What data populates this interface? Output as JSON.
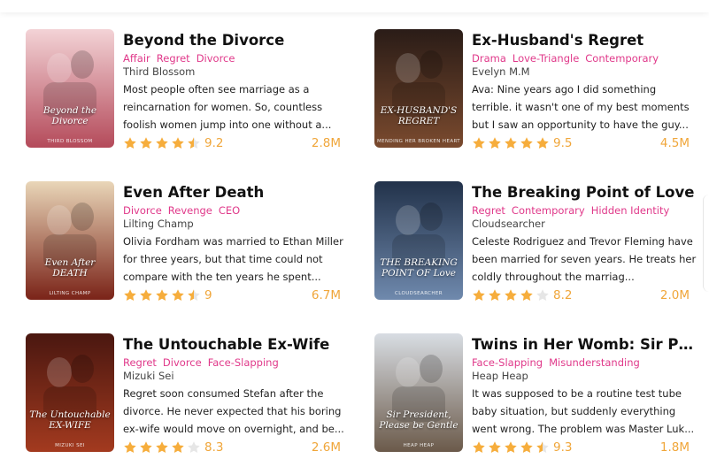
{
  "colors": {
    "accent_tag": "#e0398a",
    "star": "#f6ad3c",
    "star_empty": "#e6e6e6",
    "stat": "#f0a63a"
  },
  "books": [
    {
      "title": "Beyond the Divorce",
      "tags": [
        "Affair",
        "Regret",
        "Divorce"
      ],
      "author": "Third Blossom",
      "description": "Most people often see marriage as a reincarnation for women. So, countless foolish women jump into one without a...",
      "rating": "9.2",
      "rating_value": 4.5,
      "reads": "2.8M",
      "cover_title": "Beyond the Divorce",
      "cover_author": "THIRD BLOSSOM",
      "cover_colors": [
        "#f3d3d6",
        "#b44a5a"
      ]
    },
    {
      "title": "Ex-Husband's Regret",
      "tags": [
        "Drama",
        "Love-Triangle",
        "Contemporary"
      ],
      "author": "Evelyn M.M",
      "description": "Ava: Nine years ago I did something terrible. it wasn't one of my best moments but I saw an opportunity to have the guy...",
      "rating": "9.5",
      "rating_value": 5,
      "reads": "4.5M",
      "cover_title": "EX-HUSBAND'S REGRET",
      "cover_author": "MENDING HER BROKEN HEART",
      "cover_colors": [
        "#2a1c17",
        "#7a4a2e"
      ]
    },
    {
      "title": "Even After Death",
      "tags": [
        "Divorce",
        "Revenge",
        "CEO"
      ],
      "author": "Lilting Champ",
      "description": "Olivia Fordham was married to Ethan Miller for three years, but that time could not compare with the ten years he spent...",
      "rating": "9",
      "rating_value": 4.5,
      "reads": "6.7M",
      "cover_title": "Even After DEATH",
      "cover_author": "LILTING CHAMP",
      "cover_colors": [
        "#e9d6b8",
        "#7a2318"
      ]
    },
    {
      "title": "The Breaking Point of Love",
      "tags": [
        "Regret",
        "Contemporary",
        "Hidden Identity"
      ],
      "author": "Cloudsearcher",
      "description": "Celeste Rodriguez and Trevor Fleming have been married for seven years. He treats her coldly throughout the marriag...",
      "rating": "8.2",
      "rating_value": 4,
      "reads": "2.0M",
      "cover_title": "THE BREAKING POINT OF Love",
      "cover_author": "CLOUDSEARCHER",
      "cover_colors": [
        "#22324a",
        "#6f89ad"
      ]
    },
    {
      "title": "The Untouchable Ex-Wife",
      "tags": [
        "Regret",
        "Divorce",
        "Face-Slapping"
      ],
      "author": "Mizuki Sei",
      "description": "Regret soon consumed Stefan after the divorce. He never expected that his boring ex-wife would move on overnight, and be...",
      "rating": "8.3",
      "rating_value": 4,
      "reads": "2.6M",
      "cover_title": "The Untouchable EX-WIFE",
      "cover_author": "MIZUKI SEI",
      "cover_colors": [
        "#4a1710",
        "#a33a1f"
      ]
    },
    {
      "title": "Twins in Her Womb: Sir President, Please be Gentle",
      "tags": [
        "Face-Slapping",
        "Misunderstanding"
      ],
      "author": "Heap Heap",
      "description": "It was supposed to be a routine test tube baby situation, but suddenly everything went wrong. The problem was Master Luk...",
      "rating": "9.3",
      "rating_value": 4.5,
      "reads": "1.8M",
      "cover_title": "Sir President, Please be Gentle",
      "cover_author": "HEAP HEAP",
      "cover_colors": [
        "#d8dde3",
        "#6b5a4a"
      ]
    }
  ]
}
